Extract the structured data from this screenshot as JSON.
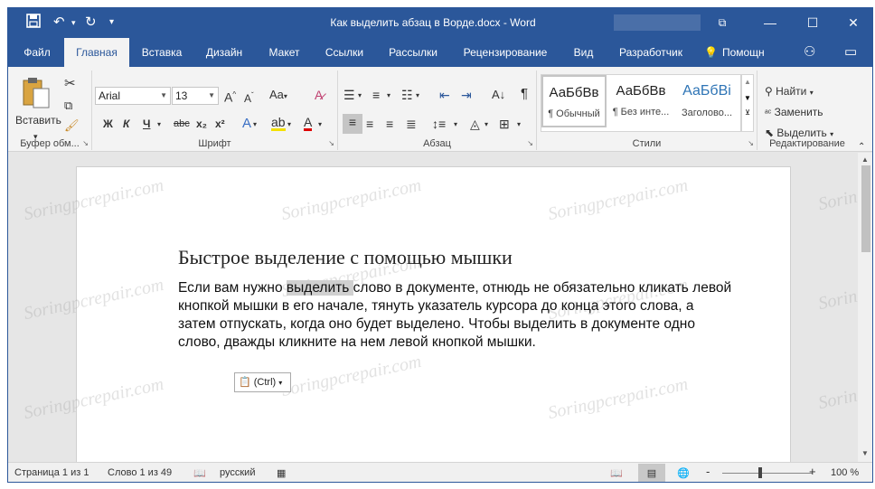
{
  "window": {
    "title": "Как выделить абзац в Ворде.docx - Word"
  },
  "quick_access": {
    "save_icon": "save-icon",
    "undo_icon": "undo-icon",
    "redo_icon": "redo-icon",
    "customize_icon": "chevron-down-icon"
  },
  "tabs": [
    {
      "label": "Файл"
    },
    {
      "label": "Главная"
    },
    {
      "label": "Вставка"
    },
    {
      "label": "Дизайн"
    },
    {
      "label": "Макет"
    },
    {
      "label": "Ссылки"
    },
    {
      "label": "Рассылки"
    },
    {
      "label": "Рецензирование"
    },
    {
      "label": "Вид"
    },
    {
      "label": "Разработчик"
    }
  ],
  "tell_me": {
    "label": "Помощн"
  },
  "ribbon": {
    "clipboard": {
      "paste_label": "Вставить",
      "group_label": "Буфер обм..."
    },
    "font": {
      "name": "Arial",
      "size": "13",
      "bold": "Ж",
      "italic": "К",
      "underline": "Ч",
      "strike": "abc",
      "subscript": "x₂",
      "superscript": "x²",
      "case": "Aa",
      "group_label": "Шрифт"
    },
    "paragraph": {
      "group_label": "Абзац"
    },
    "styles": {
      "items": [
        {
          "sample": "АаБбВв",
          "name": "¶ Обычный"
        },
        {
          "sample": "АаБбВв",
          "name": "¶ Без инте..."
        },
        {
          "sample": "АаБбВі",
          "name": "Заголово..."
        }
      ],
      "group_label": "Стили"
    },
    "editing": {
      "find": "Найти",
      "replace": "Заменить",
      "select": "Выделить",
      "group_label": "Редактирование"
    }
  },
  "document": {
    "heading": "Быстрое выделение с помощью мышки",
    "text_before": "Если вам нужно ",
    "text_selected": "выделить ",
    "text_after": "слово в документе, отнюдь не обязательно кликать левой кнопкой мышки в его начале, тянуть указатель курсора до конца этого слова, а затем отпускать, когда оно будет выделено. Чтобы выделить в документе одно слово, дважды кликните на нем левой кнопкой мышки.",
    "paste_options": "(Ctrl)",
    "watermark": "Soringpcrepair.com"
  },
  "status": {
    "page": "Страница 1 из 1",
    "words": "Слово 1 из 49",
    "language": "русский",
    "zoom": "100 %",
    "zoom_minus": "-",
    "zoom_plus": "+"
  },
  "colors": {
    "accent": "#2b579a"
  }
}
